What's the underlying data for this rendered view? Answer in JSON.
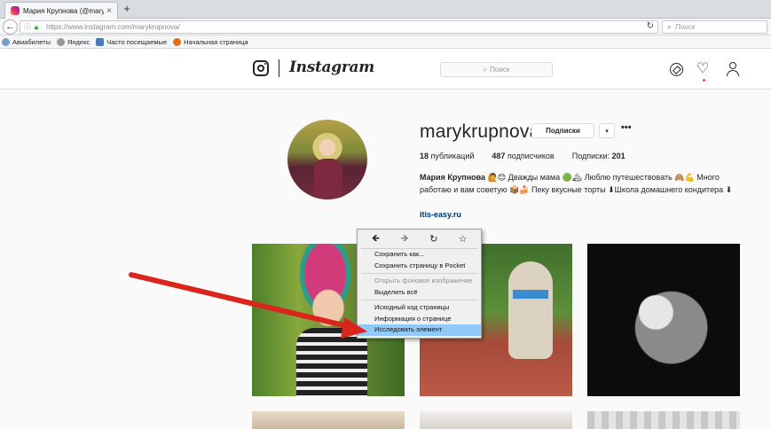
{
  "browser": {
    "tab_title": "Мария Крупнова (@mary...",
    "tab_close": "×",
    "new_tab": "+",
    "back": "←",
    "url": "https://www.instagram.com/marykrupnova/",
    "reload": "↻",
    "search_placeholder": "Поиск",
    "bookmarks": [
      {
        "label": "Авиабилеты",
        "icon_color": "#7a9cc6"
      },
      {
        "label": "Яндекс",
        "icon_color": "#999999"
      },
      {
        "label": "Часто посещаемые",
        "icon_color": "#4a7cc0"
      },
      {
        "label": "Начальная страница",
        "icon_color": "#e0701c"
      }
    ]
  },
  "instagram": {
    "wordmark": "Instagram",
    "search_placeholder": "Поиск",
    "search_icon": "search-icon",
    "nav_icons": [
      "explore-icon",
      "heart-icon",
      "profile-icon"
    ]
  },
  "profile": {
    "username": "marykrupnova",
    "follow_label": "Подписки",
    "dropdown_label": "▾",
    "more_label": "•••",
    "stats": {
      "posts_count": "18",
      "posts_label": "публикаций",
      "followers_count": "487",
      "followers_label": "подписчиков",
      "following_label": "Подписки:",
      "following_count": "201"
    },
    "bio_name": "Мария Крупнова",
    "bio_text": "🙋😊 Дважды мама 🟢🏔 Люблю путешествовать 🙈💪 Много работаю и вам советую 📦🍰 Пеку вкусные торты ⬇Школа домашнего кондитера ⬇",
    "bio_link": "itis-easy.ru"
  },
  "context_menu": {
    "nav": {
      "back": "🡸",
      "forward": "🡺",
      "reload": "↻",
      "bookmark": "☆"
    },
    "items": [
      {
        "label": "Сохранить как...",
        "state": "normal"
      },
      {
        "label": "Сохранить страницу в Pocket",
        "state": "normal"
      },
      {
        "label": "Открыть фоновое изображение",
        "state": "disabled"
      },
      {
        "label": "Выделить всё",
        "state": "normal"
      },
      {
        "label": "Исходный код страницы",
        "state": "normal"
      },
      {
        "label": "Информация о странице",
        "state": "normal"
      },
      {
        "label": "Исследовать элемент",
        "state": "highlighted"
      }
    ]
  },
  "annotation": {
    "arrow_color": "#d9251c"
  }
}
